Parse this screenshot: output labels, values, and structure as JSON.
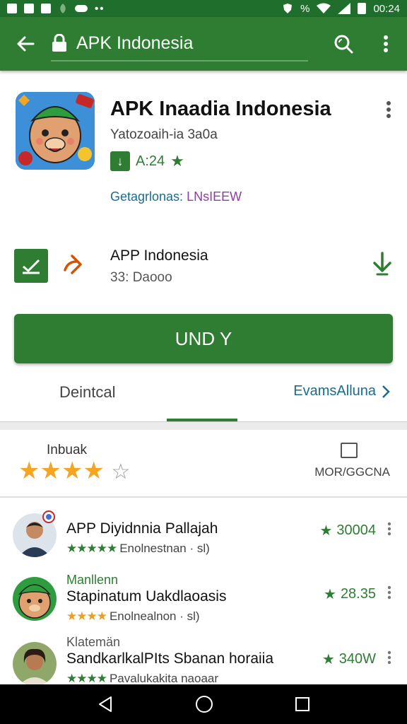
{
  "status": {
    "time": "00:24",
    "percent": "%"
  },
  "toolbar": {
    "url": "APK Indonesia"
  },
  "app": {
    "title": "APK Inaadia Indonesia",
    "developer": "Yatozoaih-ia 3a0a",
    "rating": "A:24",
    "category_label": "Getagrlonas:",
    "category_value": "LNsIEEW"
  },
  "feature": {
    "title": "APP Indonesia",
    "subtitle": "33: Daooo"
  },
  "install": {
    "label": "UND Y"
  },
  "tabs": {
    "left": "Deintcal",
    "right": "EvamsAlluna"
  },
  "rate": {
    "label": "Inbuak",
    "stars_on": 4,
    "stars_total": 5,
    "more_label": "MOR/GGCNA"
  },
  "reviews": [
    {
      "kicker": "",
      "title": "APP Diyidnnia Pallajah",
      "sub": "Enolnestnan · sl)",
      "score": "30004"
    },
    {
      "kicker": "Manllenn",
      "title": "Stapinatum Uakdlaoasis",
      "sub": "Enolnealnon · sl)",
      "score": "28.35"
    },
    {
      "kicker": "Klatemän",
      "title": "SandkarlkalPIts Sbanan horaiia",
      "sub": "Pavalukakita naoaar",
      "score": "340W"
    }
  ],
  "colors": {
    "primary": "#2e7d32",
    "status": "#1f6e2c",
    "star": "#f4a522"
  }
}
